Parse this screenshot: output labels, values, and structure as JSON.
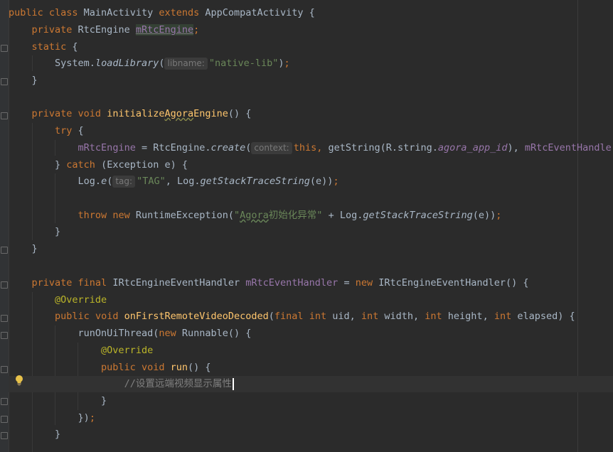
{
  "code": {
    "l1": {
      "a": "public class ",
      "b": "MainActivity ",
      "c": "extends ",
      "d": "AppCompatActivity {"
    },
    "l2": {
      "a": "private ",
      "b": "RtcEngine ",
      "c": "mRtcEngine",
      "d": ";"
    },
    "l3": {
      "a": "static ",
      "b": "{"
    },
    "l4": {
      "a": "System.",
      "b": "loadLibrary",
      "c": "(",
      "hint": "libname:",
      "d": "\"native-lib\"",
      "e": ")",
      "f": ";"
    },
    "l5": {
      "a": "}"
    },
    "l7": {
      "a": "private ",
      "b": "void ",
      "c": "initialize",
      "d": "Agora",
      "e": "Engine",
      "f": "() {"
    },
    "l8": {
      "a": "try ",
      "b": "{"
    },
    "l9": {
      "a": "mRtcEngine",
      " b": " = RtcEngine.",
      "c": "create",
      "d": "(",
      "hint": "context:",
      "e": "this, ",
      "f": "getString(R.string.",
      "g": "agora_app_id",
      "h": "), ",
      "i": "mRtcEventHandler"
    },
    "l10": {
      "a": "} ",
      "b": "catch ",
      "c": "(Exception e) {"
    },
    "l11": {
      "a": "Log.",
      "b": "e",
      "c": "(",
      "hint": "tag:",
      "d": "\"TAG\"",
      "e": ", Log.",
      "f": "getStackTraceString",
      "g": "(e))",
      "h": ";"
    },
    "l13": {
      "a": "throw ",
      "b": "new ",
      "c": "RuntimeException(",
      "d": "\"",
      "e": "Agora",
      "f": "初始化异常\"",
      "g": " + Log.",
      "h": "getStackTraceString",
      "i": "(e))",
      "j": ";"
    },
    "l14": {
      "a": "}"
    },
    "l15": {
      "a": "}"
    },
    "l17": {
      "a": "private ",
      "b": "final ",
      "c": "IRtcEngineEventHandler ",
      "d": "mRtcEventHandler",
      " e": " = ",
      "f": "new ",
      "g": "IRtcEngineEventHandler() {"
    },
    "l18": {
      "a": "@Override"
    },
    "l19": {
      "a": "public ",
      "b": "void ",
      "c": "onFirstRemoteVideoDecoded",
      "d": "(",
      "e": "final ",
      "f": "int ",
      "g": "uid, ",
      "h": "int ",
      "i": "width, ",
      "j": "int ",
      "k": "height, ",
      "l": "int ",
      "m": "elapsed) {"
    },
    "l20": {
      "a": "runOnUiThread(",
      "b": "new ",
      "c": "Runnable() {"
    },
    "l21": {
      "a": "@Override"
    },
    "l22": {
      "a": "public ",
      "b": "void ",
      "c": "run",
      "d": "() {"
    },
    "l23": {
      "a": "//设置远端视频显示属性"
    },
    "l24": {
      "a": "}"
    },
    "l25": {
      "a": "})",
      "b": ";"
    },
    "l26": {
      "a": "}"
    }
  },
  "icons": {
    "intention": "lightbulb-icon"
  },
  "colors": {
    "background": "#2b2b2b",
    "keyword": "#cc7832",
    "field": "#9876aa",
    "method": "#ffc66d",
    "string": "#6a8759",
    "annotation": "#bbb529",
    "comment": "#808080"
  }
}
